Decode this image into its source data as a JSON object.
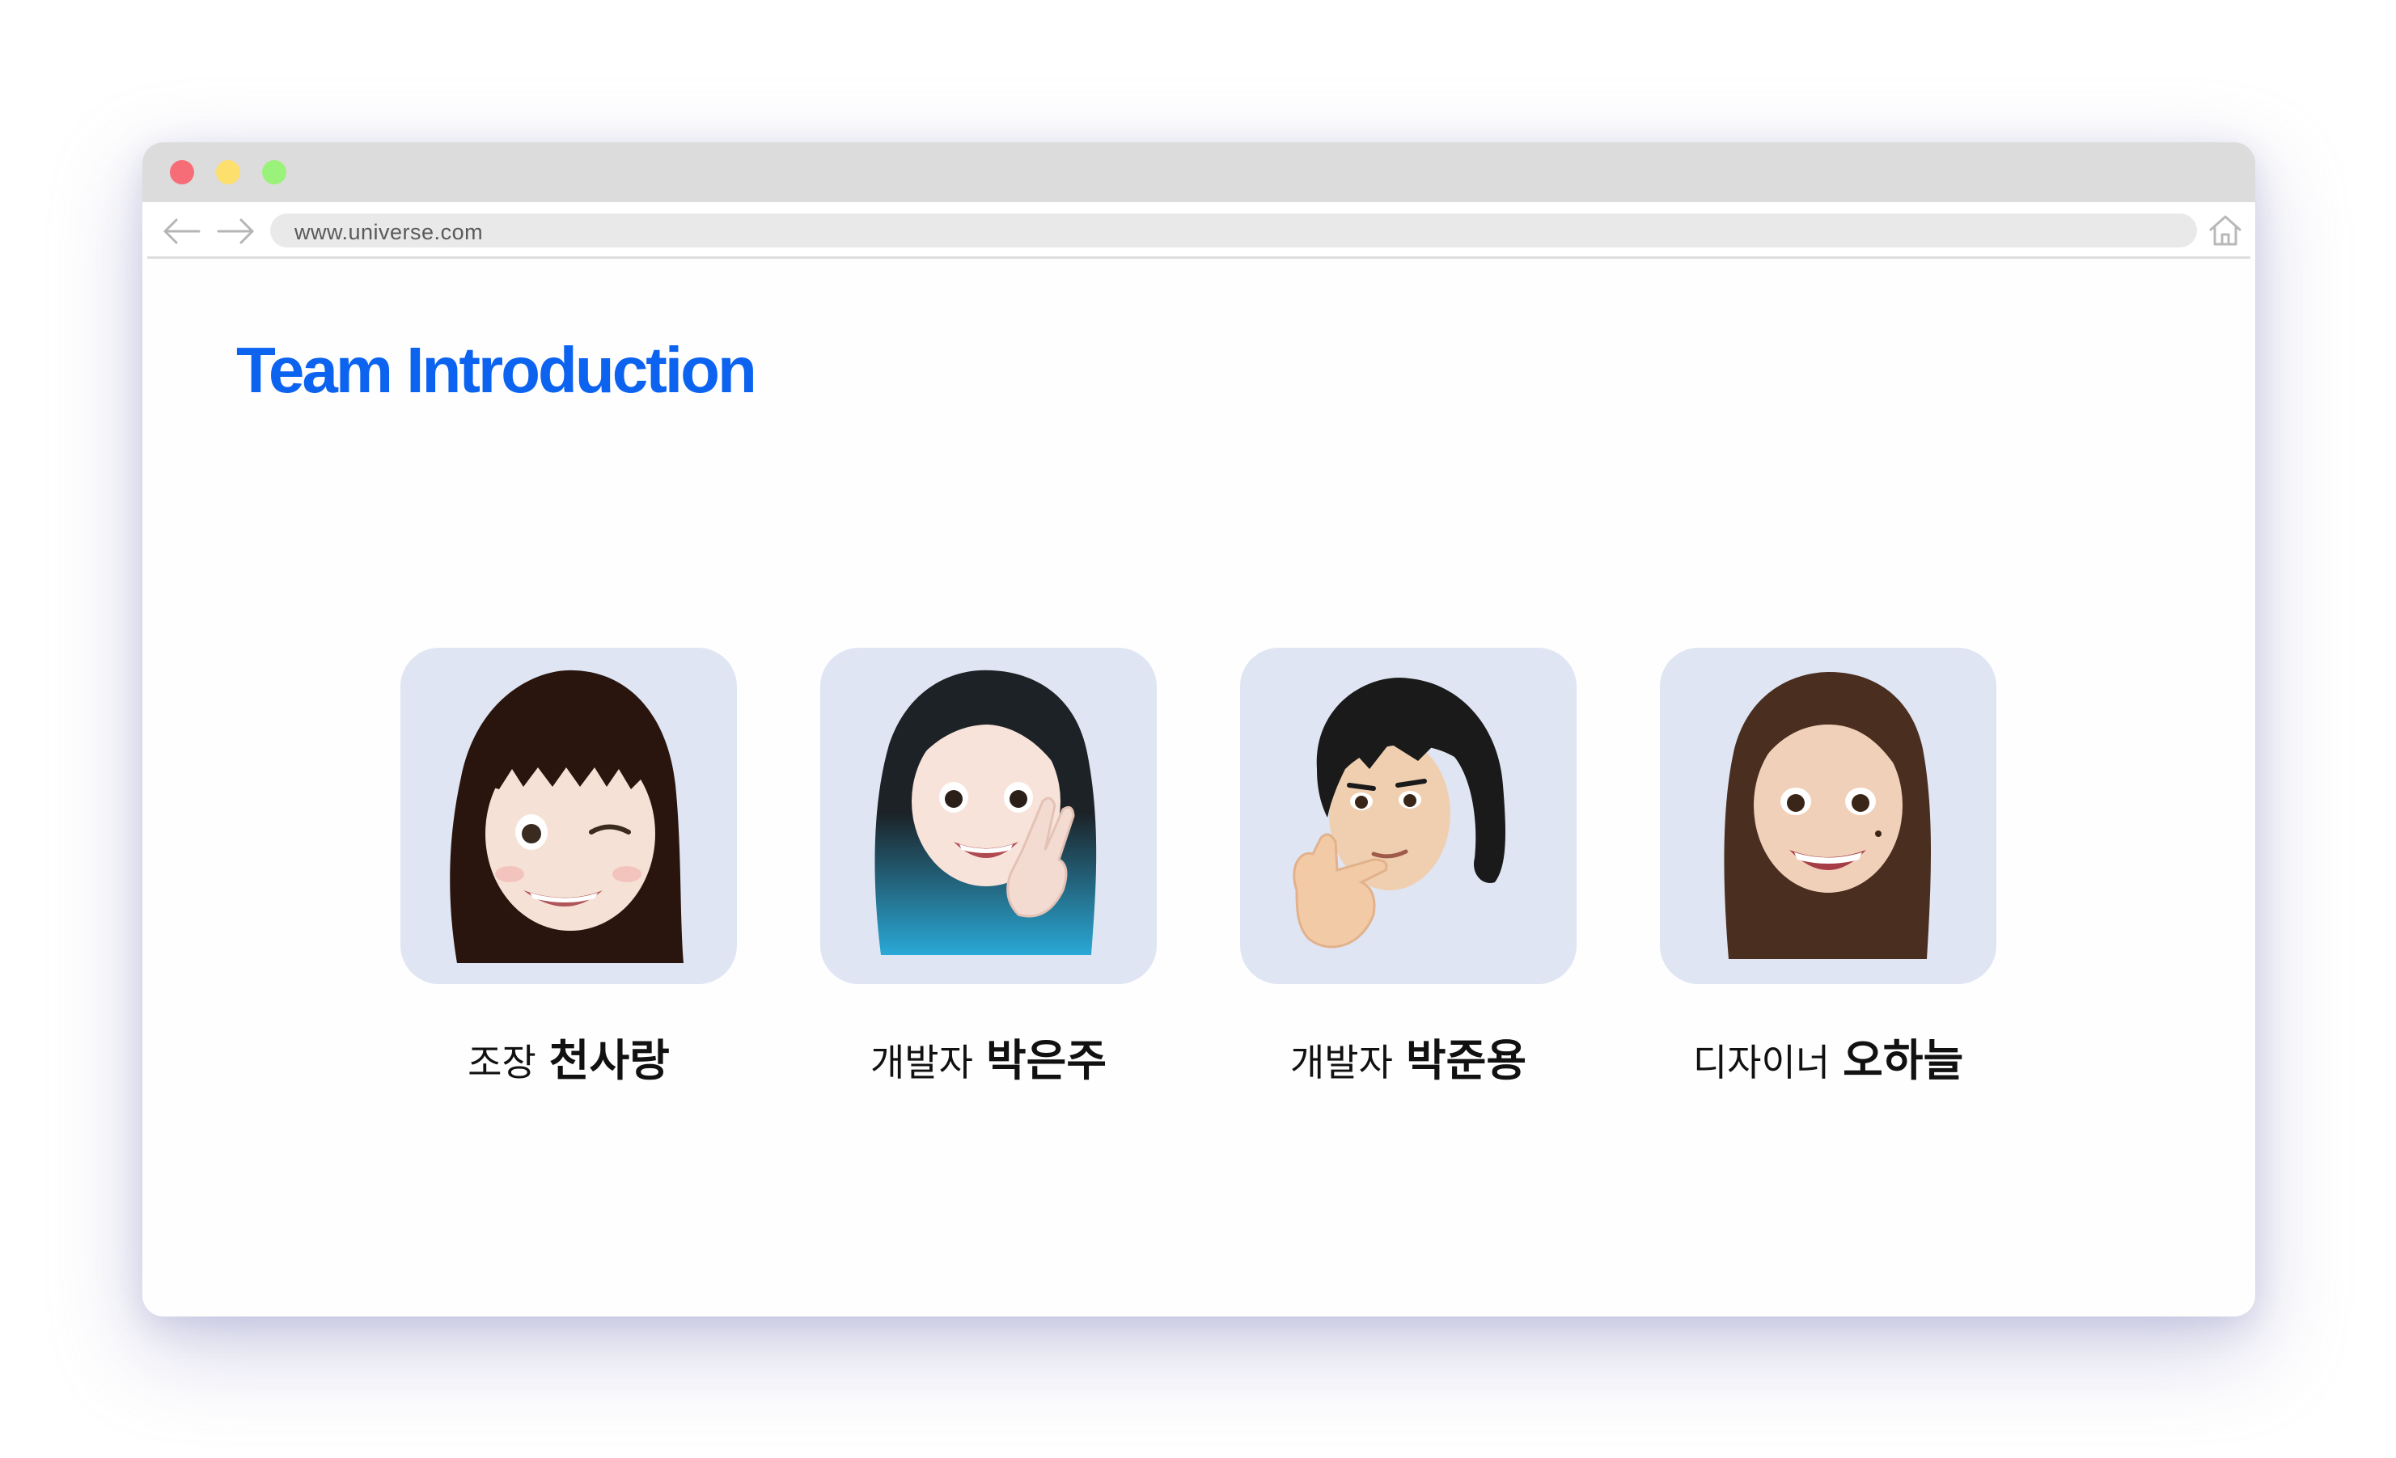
{
  "browser": {
    "url": "www.universe.com",
    "traffic_lights": [
      "#f76d77",
      "#fddf6d",
      "#9bf27a"
    ],
    "icons": [
      "back-arrow-icon",
      "forward-arrow-icon",
      "home-icon"
    ]
  },
  "page": {
    "title": "Team Introduction",
    "accent_color": "#0c63f0",
    "card_color": "#dfe5f3"
  },
  "team": [
    {
      "role": "조장",
      "name": "천사랑",
      "avatar": "winking-girl-memoji"
    },
    {
      "role": "개발자",
      "name": "박은주",
      "avatar": "peace-sign-girl-memoji"
    },
    {
      "role": "개발자",
      "name": "박준용",
      "avatar": "thinking-boy-memoji"
    },
    {
      "role": "디자이너",
      "name": "오하늘",
      "avatar": "smiling-girl-memoji"
    }
  ]
}
